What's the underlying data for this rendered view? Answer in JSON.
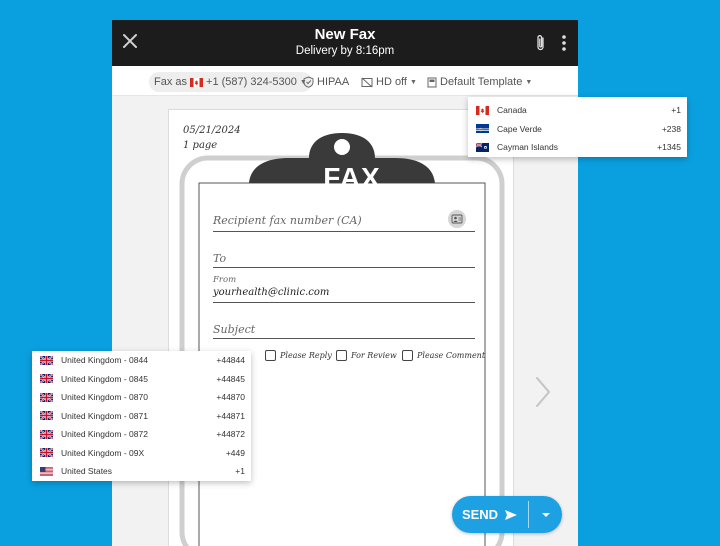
{
  "header": {
    "title": "New Fax",
    "subtitle": "Delivery by 8:16pm"
  },
  "toolbar": {
    "fax_as_label": "Fax as",
    "fax_as_number": "+1 (587) 324-5300",
    "hipaa_label": "HIPAA",
    "hd_label": "HD off",
    "template_label": "Default Template"
  },
  "page": {
    "date": "05/21/2024",
    "page_count": "1 page",
    "fax_header": "FAX",
    "recipient_placeholder": "Recipient fax number (CA)",
    "to_placeholder": "To",
    "from_label": "From",
    "from_value": "yourhealth@clinic.com",
    "subject_placeholder": "Subject",
    "checkboxes": [
      "Please Reply",
      "For Review",
      "Please Comment"
    ]
  },
  "send": {
    "label": "SEND"
  },
  "dropdown_top": [
    {
      "name": "Canada",
      "code": "+1",
      "flag": "canada-flag"
    },
    {
      "name": "Cape Verde",
      "code": "+238",
      "flag": "cape-verde-flag"
    },
    {
      "name": "Cayman Islands",
      "code": "+1345",
      "flag": "cayman-islands-flag"
    }
  ],
  "dropdown_left": [
    {
      "name": "United Kingdom - 0844",
      "code": "+44844",
      "flag": "uk-flag"
    },
    {
      "name": "United Kingdom - 0845",
      "code": "+44845",
      "flag": "uk-flag"
    },
    {
      "name": "United Kingdom - 0870",
      "code": "+44870",
      "flag": "uk-flag"
    },
    {
      "name": "United Kingdom - 0871",
      "code": "+44871",
      "flag": "uk-flag"
    },
    {
      "name": "United Kingdom - 0872",
      "code": "+44872",
      "flag": "uk-flag"
    },
    {
      "name": "United Kingdom - 09X",
      "code": "+449",
      "flag": "uk-flag"
    },
    {
      "name": "United States",
      "code": "+1",
      "flag": "us-flag"
    }
  ],
  "colors": {
    "background": "#0aa0e0",
    "titlebar": "#1c1c1c",
    "send_button": "#1da1e2",
    "clipboard": "#3a3a3a"
  }
}
